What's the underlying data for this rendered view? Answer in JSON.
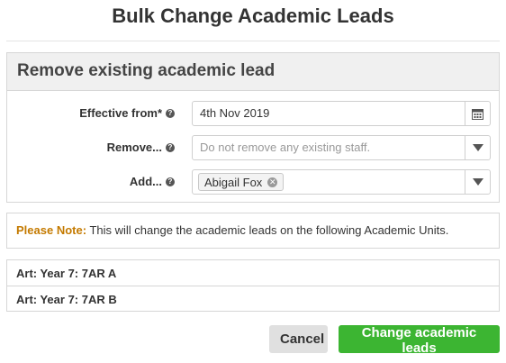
{
  "dialog": {
    "title": "Bulk Change Academic Leads"
  },
  "section": {
    "heading": "Remove existing academic lead"
  },
  "form": {
    "effective_from": {
      "label": "Effective from*",
      "value": "4th Nov 2019"
    },
    "remove": {
      "label": "Remove...",
      "placeholder": "Do not remove any existing staff."
    },
    "add": {
      "label": "Add...",
      "tags": [
        "Abigail Fox"
      ]
    }
  },
  "note": {
    "label": "Please Note:",
    "text": "This will change the academic leads on the following Academic Units."
  },
  "units": [
    {
      "label": "Art: Year 7: 7AR A"
    },
    {
      "label": "Art: Year 7: 7AR B"
    }
  ],
  "actions": {
    "cancel_label": "Cancel",
    "submit_label": "Change academic leads"
  },
  "colors": {
    "submit": "#3cb532",
    "note_label": "#c47a00"
  }
}
